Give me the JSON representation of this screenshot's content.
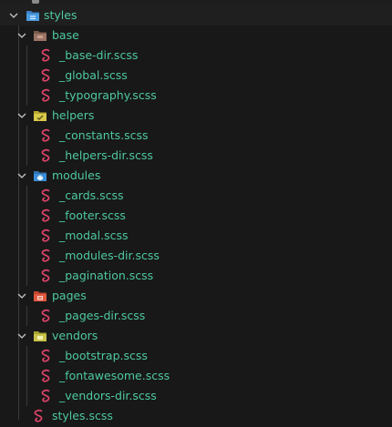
{
  "explorer": {
    "root": {
      "label": "styles"
    },
    "folders": {
      "base": {
        "label": "base",
        "files": [
          "_base-dir.scss",
          "_global.scss",
          "_typography.scss"
        ]
      },
      "helpers": {
        "label": "helpers",
        "files": [
          "_constants.scss",
          "_helpers-dir.scss"
        ]
      },
      "modules": {
        "label": "modules",
        "files": [
          "_cards.scss",
          "_footer.scss",
          "_modal.scss",
          "_modules-dir.scss",
          "_pagination.scss"
        ]
      },
      "pages": {
        "label": "pages",
        "files": [
          "_pages-dir.scss"
        ]
      },
      "vendors": {
        "label": "vendors",
        "files": [
          "_bootstrap.scss",
          "_fontawesome.scss",
          "_vendors-dir.scss"
        ]
      }
    },
    "root_file": "styles.scss"
  },
  "colors": {
    "background": "#181818",
    "text": "#4ec9a0",
    "sass": "#e0446b",
    "folder_base": "#8a6a5a",
    "folder_helpers": "#d8c94a",
    "folder_modules": "#3b8fd8",
    "folder_pages": "#e0583e",
    "folder_vendors": "#c9c24a"
  },
  "icons": {
    "chevron": "chevron-down-icon",
    "sass": "sass-file-icon"
  }
}
